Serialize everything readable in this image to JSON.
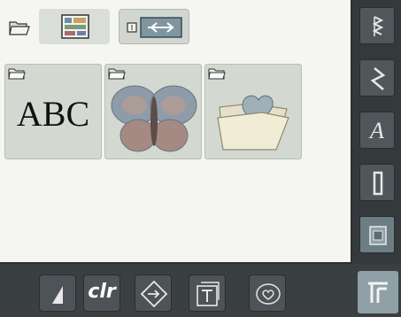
{
  "main": {
    "tiles": [
      {
        "label": "ABC",
        "kind": "alphabets"
      },
      {
        "kind": "embroidery-motifs"
      },
      {
        "kind": "personal-designs"
      }
    ]
  },
  "right_bar": {
    "items": [
      "stitch-selection",
      "decorative-stitches",
      "alphabets",
      "buttonholes",
      "embroidery"
    ],
    "alphabet_glyph": "A"
  },
  "bottom_bar": {
    "items": [
      "tension",
      "clear",
      "navigation",
      "text-info",
      "personal-program",
      "menu"
    ],
    "clr_label": "clr"
  },
  "colors": {
    "panel": "#f5f5f1",
    "tile": "#d3d9d0",
    "dark": "#3a3f41",
    "accent": "#8fa0a6"
  }
}
